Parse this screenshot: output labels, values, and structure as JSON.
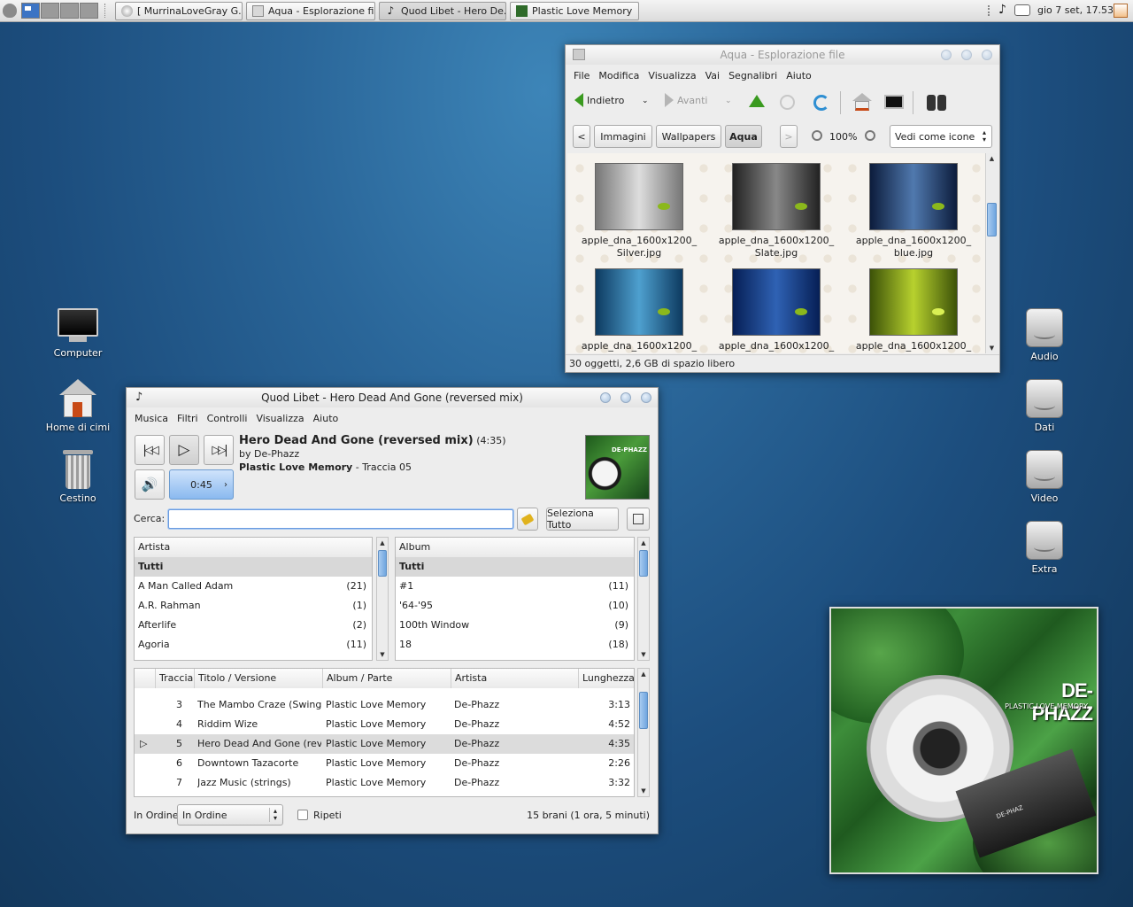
{
  "panel": {
    "tasks": [
      {
        "label": "[ MurrinaLoveGray G...",
        "icon": "browser-icon"
      },
      {
        "label": "Aqua - Esplorazione file",
        "icon": "folder-icon"
      },
      {
        "label": "Quod Libet - Hero De...",
        "icon": "quodlibet-icon"
      },
      {
        "label": "Plastic Love Memory",
        "icon": "album-art-icon"
      }
    ],
    "clock": "gio 7 set, 17.53"
  },
  "desktop": {
    "left_icons": [
      {
        "label": "Computer"
      },
      {
        "label": "Home di cimi"
      },
      {
        "label": "Cestino"
      }
    ],
    "right_icons": [
      {
        "label": "Audio"
      },
      {
        "label": "Dati"
      },
      {
        "label": "Video"
      },
      {
        "label": "Extra"
      }
    ]
  },
  "filemanager": {
    "title": "Aqua - Esplorazione file",
    "menu": [
      "File",
      "Modifica",
      "Visualizza",
      "Vai",
      "Segnalibri",
      "Aiuto"
    ],
    "back_label": "Indietro",
    "forward_label": "Avanti",
    "path": [
      "Immagini",
      "Wallpapers",
      "Aqua"
    ],
    "zoom": "100%",
    "view_mode": "Vedi come icone",
    "files": [
      {
        "line1": "apple_dna_1600x1200_",
        "line2": "Silver.jpg",
        "color": "#b9b9b9"
      },
      {
        "line1": "apple_dna_1600x1200_",
        "line2": "Slate.jpg",
        "color": "#5a5a5a"
      },
      {
        "line1": "apple_dna_1600x1200_",
        "line2": "blue.jpg",
        "color": "#27497a"
      },
      {
        "line1": "apple_dna_1600x1200_",
        "line2": "",
        "color": "#2a6f9d"
      },
      {
        "line1": "apple_dna_1600x1200_",
        "line2": "",
        "color": "#173f7f"
      },
      {
        "line1": "apple_dna_1600x1200_",
        "line2": "",
        "color": "#7c9a14"
      }
    ],
    "status": "30 oggetti, 2,6 GB di spazio libero"
  },
  "player": {
    "title": "Quod Libet - Hero Dead And Gone (reversed mix)",
    "menu": [
      "Musica",
      "Filtri",
      "Controlli",
      "Visualizza",
      "Aiuto"
    ],
    "position": "0:45",
    "song_title": "Hero Dead And Gone (reversed mix)",
    "song_length": "(4:35)",
    "artist_line": "by De-Phazz",
    "album": "Plastic Love Memory",
    "track_info": " - Traccia 05",
    "search_label": "Cerca:",
    "search_value": "",
    "select_all": "Seleziona Tutto",
    "artist_pane": {
      "header": "Artista",
      "rows": [
        {
          "name": "Tutti",
          "count": ""
        },
        {
          "name": "A Man Called Adam",
          "count": "(21)"
        },
        {
          "name": "A.R. Rahman",
          "count": "(1)"
        },
        {
          "name": "Afterlife",
          "count": "(2)"
        },
        {
          "name": "Agoria",
          "count": "(11)"
        }
      ]
    },
    "album_pane": {
      "header": "Album",
      "rows": [
        {
          "name": "Tutti",
          "count": ""
        },
        {
          "name": "#1",
          "count": "(11)"
        },
        {
          "name": "'64-'95",
          "count": "(10)"
        },
        {
          "name": "100th Window",
          "count": "(9)"
        },
        {
          "name": "18",
          "count": "(18)"
        }
      ]
    },
    "songs": {
      "headers": [
        "Traccia",
        "Titolo / Versione",
        "Album / Parte",
        "Artista",
        "Lunghezza"
      ],
      "rows": [
        {
          "track": "3",
          "title": "The Mambo Craze (Swing ...",
          "album": "Plastic Love Memory",
          "artist": "De-Phazz",
          "length": "3:13",
          "playing": ""
        },
        {
          "track": "4",
          "title": "Riddim Wize",
          "album": "Plastic Love Memory",
          "artist": "De-Phazz",
          "length": "4:52",
          "playing": ""
        },
        {
          "track": "5",
          "title": "Hero Dead And Gone (rev...",
          "album": "Plastic Love Memory",
          "artist": "De-Phazz",
          "length": "4:35",
          "playing": "▷"
        },
        {
          "track": "6",
          "title": "Downtown Tazacorte",
          "album": "Plastic Love Memory",
          "artist": "De-Phazz",
          "length": "2:26",
          "playing": ""
        },
        {
          "track": "7",
          "title": "Jazz Music (strings)",
          "album": "Plastic Love Memory",
          "artist": "De-Phazz",
          "length": "3:32",
          "playing": ""
        }
      ]
    },
    "order_label": "In Ordine",
    "order_value": "In Ordine",
    "repeat_label": "Ripeti",
    "summary": "15 brani (1 ora, 5 minuti)"
  },
  "cover": {
    "band": "DE-PHAZZ",
    "album": "PLASTIC LOVE MEMORY",
    "label": "DE-PHAZ"
  }
}
